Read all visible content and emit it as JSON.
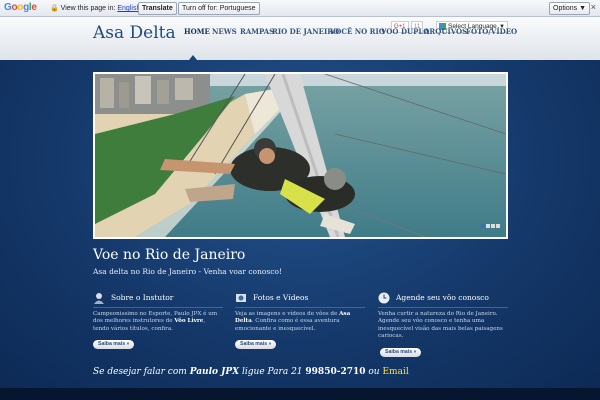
{
  "translate_bar": {
    "google_logo": "Google",
    "view_text": "View this page in:",
    "language": "English",
    "translate_button": "Translate",
    "turn_off_button": "Turn off for: Portuguese",
    "options_button": "Options ▼",
    "close": "×"
  },
  "header": {
    "social_gplus": "G+1",
    "social_count": "11",
    "select_language": "Select Language",
    "logo": "Asa Delta",
    "nav": [
      "HOME",
      "NEWS",
      "RAMPAS",
      "RIO DE JANEIRO",
      "VOCÊ NO RIO",
      "VOO DUPLO",
      "ARQUIVOS",
      "FOTO/VÍDEO"
    ],
    "active_index": 0
  },
  "hero": {
    "title": "Voe no Rio de Janeiro",
    "subtitle": "Asa delta no Rio de Janeiro - Venha voar conosco!",
    "slides": 4,
    "active_slide": 0
  },
  "columns": [
    {
      "title": "Sobre o Instutor",
      "icon": "instructor-icon",
      "text_parts": [
        "Campeonissimo no Esporte, Paulo JPX é um dos melhores instrutores de ",
        "Vôo Livre",
        ", tendo vários títulos, confira."
      ],
      "button": "Saiba mais »"
    },
    {
      "title": "Fotos e Vídeos",
      "icon": "photo-icon",
      "text_parts": [
        "Veja as imagens e vídeos de vôos de ",
        "Asa Delta",
        ". Confira como é essa aventura emocionante e inesquecível."
      ],
      "button": "Saiba mais »"
    },
    {
      "title": "Agende seu vôo conosco",
      "icon": "clock-icon",
      "text_parts": [
        "Venha curtir a natureza do Rio de Janeiro. Agende seu vôo conosco e tenha uma inesquecível visão das mais belas paisagens cariocas.",
        "",
        ""
      ],
      "button": "Saiba mais »"
    }
  ],
  "contact": {
    "prefix": "Se desejar falar com",
    "name": "Paulo JPX",
    "middle": "ligue Para 21",
    "phone": "99850-2710",
    "or": "ou",
    "email": "Email"
  },
  "colors": {
    "brand_blue": "#1d4a82",
    "background": "#15396b",
    "email": "#ffe03a"
  }
}
